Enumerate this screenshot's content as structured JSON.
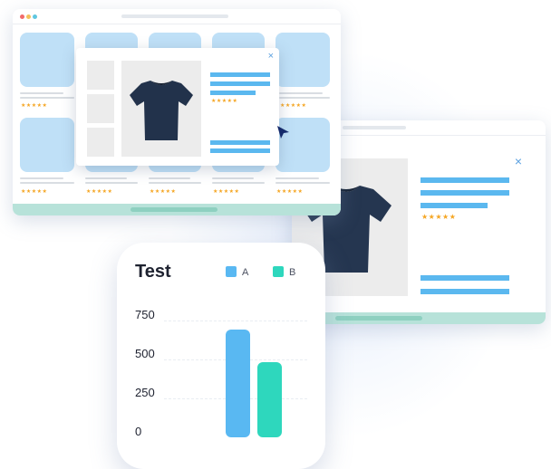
{
  "colors": {
    "card": "#bfe0f7",
    "accent_blue": "#5bb8ef",
    "series_a": "#59b8f2",
    "series_b": "#2ed7bd",
    "footer": "#b7e2d9",
    "star": "#f5a623"
  },
  "icons": {
    "close": "×",
    "stars": "★★★★★",
    "cursor": "arrow-cursor-icon"
  },
  "chart_data": {
    "type": "bar",
    "title": "Test",
    "categories": [
      "A",
      "B"
    ],
    "series": [
      {
        "name": "A",
        "values": [
          690
        ]
      },
      {
        "name": "B",
        "values": [
          480
        ]
      }
    ],
    "yticks": [
      "750",
      "500",
      "250",
      "0"
    ],
    "ylim": [
      0,
      750
    ],
    "legend": "top-right"
  }
}
